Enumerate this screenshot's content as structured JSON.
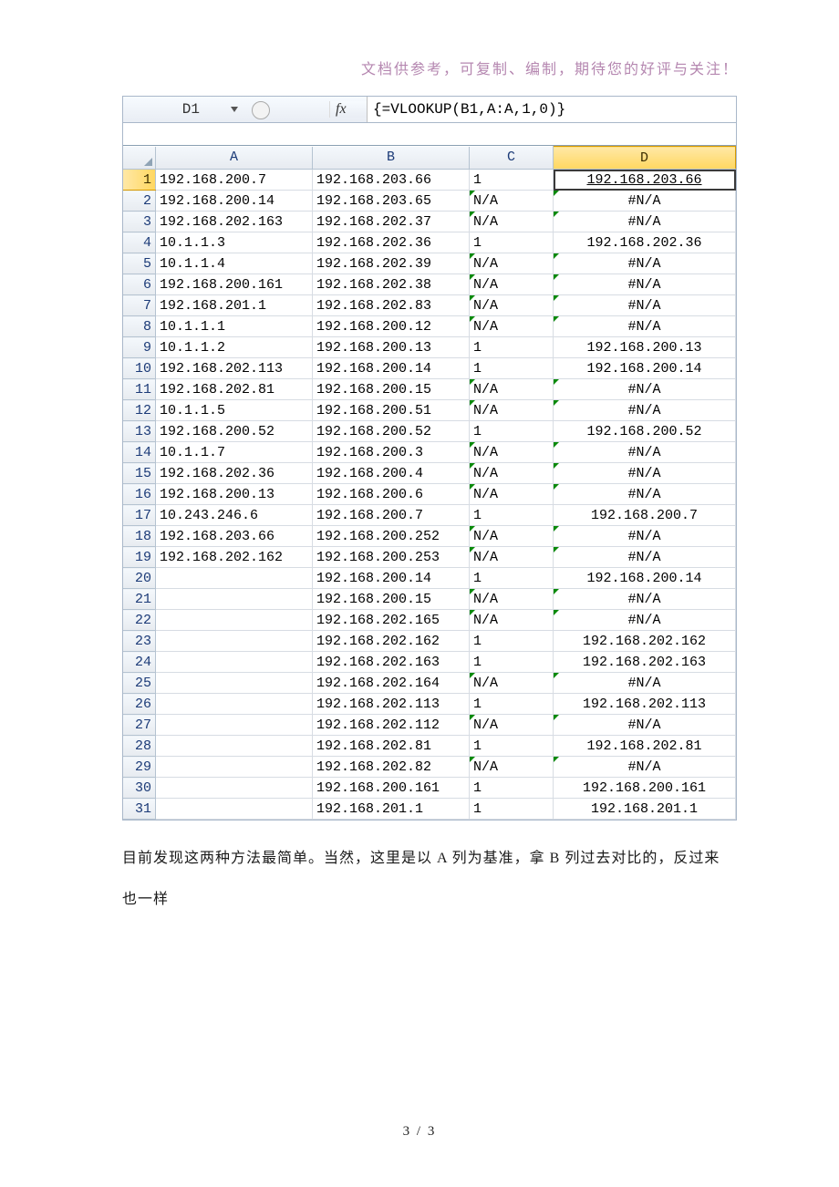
{
  "header_note": "文档供参考，可复制、编制，期待您的好评与关注！",
  "name_box": "D1",
  "fx_label": "fx",
  "formula": "{=VLOOKUP(B1,A:A,1,0)}",
  "col_labels": [
    "A",
    "B",
    "C",
    "D"
  ],
  "active_col_index": 3,
  "active_row_index": 0,
  "fill_handle_row_index": 30,
  "rows": [
    {
      "n": "1",
      "A": "192.168.200.7",
      "B": "192.168.203.66",
      "C": "1",
      "D": "192.168.203.66",
      "C_err": false,
      "D_err": false
    },
    {
      "n": "2",
      "A": "192.168.200.14",
      "B": "192.168.203.65",
      "C": "N/A",
      "D": "#N/A",
      "C_err": true,
      "D_err": true
    },
    {
      "n": "3",
      "A": "192.168.202.163",
      "B": "192.168.202.37",
      "C": "N/A",
      "D": "#N/A",
      "C_err": true,
      "D_err": true
    },
    {
      "n": "4",
      "A": "10.1.1.3",
      "B": "192.168.202.36",
      "C": "1",
      "D": "192.168.202.36",
      "C_err": false,
      "D_err": false
    },
    {
      "n": "5",
      "A": "10.1.1.4",
      "B": "192.168.202.39",
      "C": "N/A",
      "D": "#N/A",
      "C_err": true,
      "D_err": true
    },
    {
      "n": "6",
      "A": "192.168.200.161",
      "B": "192.168.202.38",
      "C": "N/A",
      "D": "#N/A",
      "C_err": true,
      "D_err": true
    },
    {
      "n": "7",
      "A": "192.168.201.1",
      "B": "192.168.202.83",
      "C": "N/A",
      "D": "#N/A",
      "C_err": true,
      "D_err": true
    },
    {
      "n": "8",
      "A": "10.1.1.1",
      "B": "192.168.200.12",
      "C": "N/A",
      "D": "#N/A",
      "C_err": true,
      "D_err": true
    },
    {
      "n": "9",
      "A": "10.1.1.2",
      "B": "192.168.200.13",
      "C": "1",
      "D": "192.168.200.13",
      "C_err": false,
      "D_err": false
    },
    {
      "n": "10",
      "A": "192.168.202.113",
      "B": "192.168.200.14",
      "C": "1",
      "D": "192.168.200.14",
      "C_err": false,
      "D_err": false
    },
    {
      "n": "11",
      "A": "192.168.202.81",
      "B": "192.168.200.15",
      "C": "N/A",
      "D": "#N/A",
      "C_err": true,
      "D_err": true
    },
    {
      "n": "12",
      "A": "10.1.1.5",
      "B": "192.168.200.51",
      "C": "N/A",
      "D": "#N/A",
      "C_err": true,
      "D_err": true
    },
    {
      "n": "13",
      "A": "192.168.200.52",
      "B": "192.168.200.52",
      "C": "1",
      "D": "192.168.200.52",
      "C_err": false,
      "D_err": false
    },
    {
      "n": "14",
      "A": "10.1.1.7",
      "B": "192.168.200.3",
      "C": "N/A",
      "D": "#N/A",
      "C_err": true,
      "D_err": true
    },
    {
      "n": "15",
      "A": "192.168.202.36",
      "B": "192.168.200.4",
      "C": "N/A",
      "D": "#N/A",
      "C_err": true,
      "D_err": true
    },
    {
      "n": "16",
      "A": "192.168.200.13",
      "B": "192.168.200.6",
      "C": "N/A",
      "D": "#N/A",
      "C_err": true,
      "D_err": true
    },
    {
      "n": "17",
      "A": "10.243.246.6",
      "B": "192.168.200.7",
      "C": "1",
      "D": "192.168.200.7",
      "C_err": false,
      "D_err": false
    },
    {
      "n": "18",
      "A": "192.168.203.66",
      "B": "192.168.200.252",
      "C": "N/A",
      "D": "#N/A",
      "C_err": true,
      "D_err": true
    },
    {
      "n": "19",
      "A": "192.168.202.162",
      "B": "192.168.200.253",
      "C": "N/A",
      "D": "#N/A",
      "C_err": true,
      "D_err": true
    },
    {
      "n": "20",
      "A": "",
      "B": "192.168.200.14",
      "C": "1",
      "D": "192.168.200.14",
      "C_err": false,
      "D_err": false
    },
    {
      "n": "21",
      "A": "",
      "B": "192.168.200.15",
      "C": "N/A",
      "D": "#N/A",
      "C_err": true,
      "D_err": true
    },
    {
      "n": "22",
      "A": "",
      "B": "192.168.202.165",
      "C": "N/A",
      "D": "#N/A",
      "C_err": true,
      "D_err": true
    },
    {
      "n": "23",
      "A": "",
      "B": "192.168.202.162",
      "C": "1",
      "D": "192.168.202.162",
      "C_err": false,
      "D_err": false
    },
    {
      "n": "24",
      "A": "",
      "B": "192.168.202.163",
      "C": "1",
      "D": "192.168.202.163",
      "C_err": false,
      "D_err": false
    },
    {
      "n": "25",
      "A": "",
      "B": "192.168.202.164",
      "C": "N/A",
      "D": "#N/A",
      "C_err": true,
      "D_err": true
    },
    {
      "n": "26",
      "A": "",
      "B": "192.168.202.113",
      "C": "1",
      "D": "192.168.202.113",
      "C_err": false,
      "D_err": false
    },
    {
      "n": "27",
      "A": "",
      "B": "192.168.202.112",
      "C": "N/A",
      "D": "#N/A",
      "C_err": true,
      "D_err": true
    },
    {
      "n": "28",
      "A": "",
      "B": "192.168.202.81",
      "C": "1",
      "D": "192.168.202.81",
      "C_err": false,
      "D_err": false
    },
    {
      "n": "29",
      "A": "",
      "B": "192.168.202.82",
      "C": "N/A",
      "D": "#N/A",
      "C_err": true,
      "D_err": true
    },
    {
      "n": "30",
      "A": "",
      "B": "192.168.200.161",
      "C": "1",
      "D": "192.168.200.161",
      "C_err": false,
      "D_err": false
    },
    {
      "n": "31",
      "A": "",
      "B": "192.168.201.1",
      "C": "1",
      "D": "192.168.201.1",
      "C_err": false,
      "D_err": false
    }
  ],
  "body_para": "目前发现这两种方法最简单。当然，这里是以 A 列为基准，拿 B 列过去对比的，反过来也一样",
  "page_number": "3 / 3"
}
